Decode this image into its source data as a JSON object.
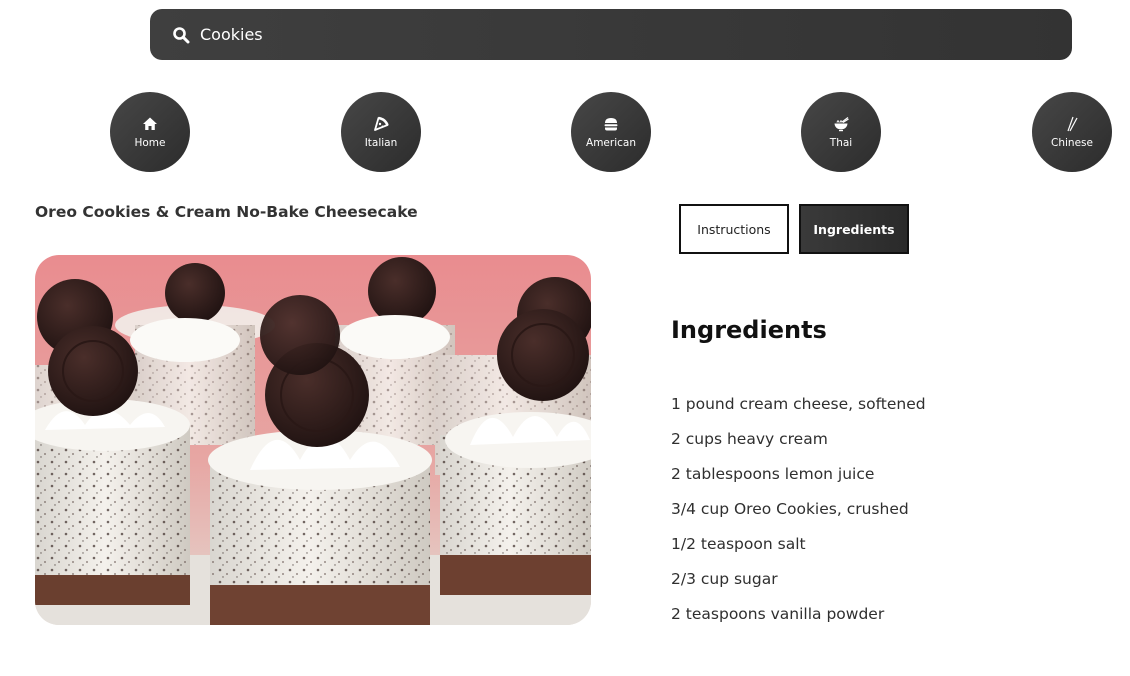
{
  "search": {
    "value": "Cookies",
    "icon": "search-icon"
  },
  "categories": [
    {
      "label": "Home",
      "icon": "home-icon"
    },
    {
      "label": "Italian",
      "icon": "pizza-icon"
    },
    {
      "label": "American",
      "icon": "burger-icon"
    },
    {
      "label": "Thai",
      "icon": "noodle-bowl-icon"
    },
    {
      "label": "Chinese",
      "icon": "chopsticks-icon"
    }
  ],
  "recipe": {
    "title": "Oreo Cookies & Cream No-Bake Cheesecake"
  },
  "tabs": {
    "instructions": "Instructions",
    "ingredients": "Ingredients",
    "active": "Ingredients"
  },
  "ingredients": {
    "heading": "Ingredients",
    "items": [
      "1 pound cream cheese, softened",
      "2 cups heavy cream",
      "2 tablespoons lemon juice",
      "3/4 cup Oreo Cookies, crushed",
      "1/2 teaspoon salt",
      "2/3 cup sugar",
      "2 teaspoons vanilla powder"
    ]
  }
}
